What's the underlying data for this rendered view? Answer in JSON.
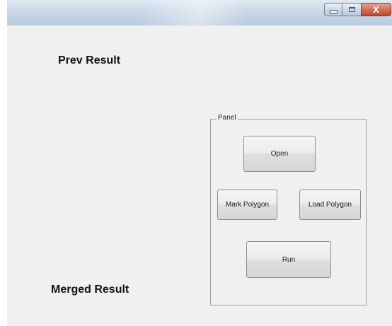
{
  "window": {
    "caption_buttons": {
      "minimize": "minimize-icon",
      "maximize": "maximize-icon",
      "close_glyph": "X"
    }
  },
  "labels": {
    "prev_result": "Prev Result",
    "merged_result": "Merged Result"
  },
  "panel": {
    "legend": "Panel",
    "buttons": {
      "open": "Open",
      "mark_polygon": "Mark Polygon",
      "load_polygon": "Load Polygon",
      "run": "Run"
    }
  },
  "colors": {
    "window_bg": "#f0f0f0",
    "titlebar": "#c9d8e8",
    "close_button": "#c0472f"
  }
}
